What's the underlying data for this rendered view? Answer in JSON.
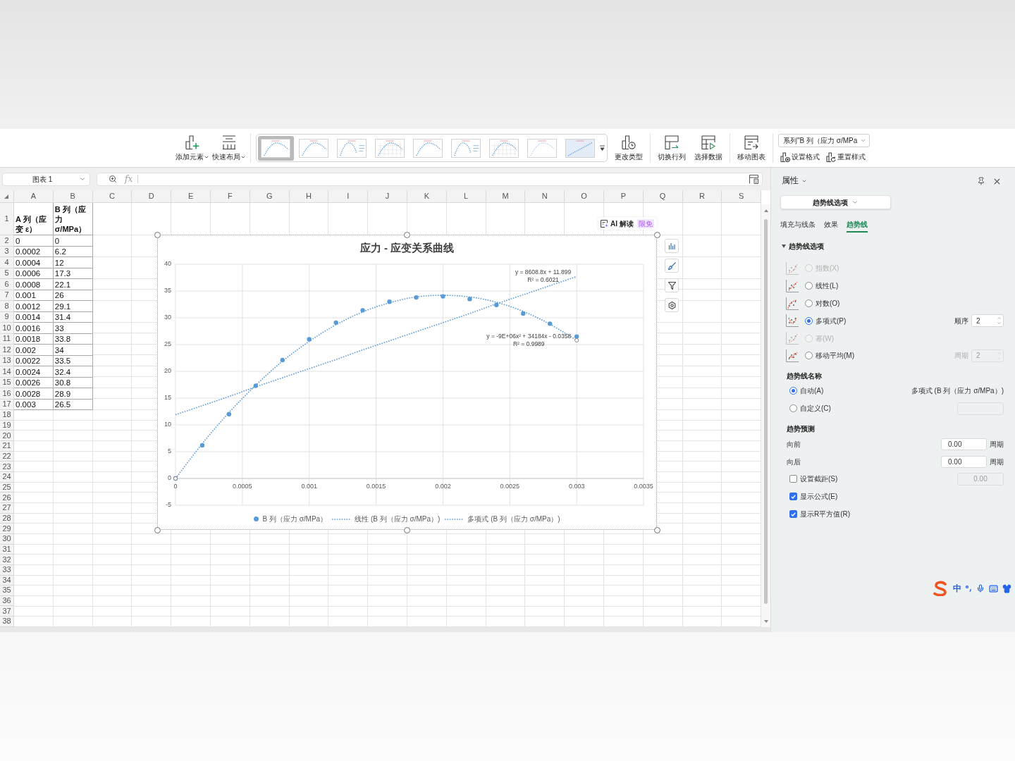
{
  "ribbon": {
    "groups": [
      {
        "kind": "buttons",
        "buttons": [
          {
            "kind": "add_element",
            "label": "添加元素",
            "dropdown": true
          },
          {
            "kind": "quick_layout",
            "label": "快速布局",
            "dropdown": true
          }
        ]
      },
      {
        "kind": "styles",
        "styles": [
          {
            "kind": "curve",
            "selected": true
          },
          {
            "kind": "curve",
            "selected": false
          },
          {
            "kind": "legend",
            "selected": false
          },
          {
            "kind": "grid",
            "selected": false
          },
          {
            "kind": "curve",
            "selected": false
          },
          {
            "kind": "legend",
            "selected": false
          },
          {
            "kind": "grid",
            "selected": false
          },
          {
            "kind": "faint",
            "selected": false
          },
          {
            "kind": "filled",
            "selected": false
          }
        ]
      },
      {
        "kind": "buttons",
        "buttons": [
          {
            "kind": "change_type",
            "label": "更改类型",
            "dropdown": false
          }
        ]
      },
      {
        "kind": "buttons",
        "buttons": [
          {
            "kind": "switch_row_column",
            "label": "切换行列",
            "dropdown": false
          },
          {
            "kind": "select_data",
            "label": "选择数据",
            "dropdown": false
          }
        ]
      },
      {
        "kind": "buttons",
        "buttons": [
          {
            "kind": "move_chart",
            "label": "移动图表",
            "dropdown": false
          }
        ]
      },
      {
        "kind": "series",
        "select": {
          "value": "系列\"B 列（应力 σ/MPa"
        },
        "buttons": [
          {
            "kind": "format",
            "label": "设置格式"
          },
          {
            "kind": "reset",
            "label": "重置样式"
          }
        ]
      }
    ]
  },
  "name_box": {
    "value": "图表 1"
  },
  "formula_bar": {
    "fx": "fx"
  },
  "sheet": {
    "columns": [
      "A",
      "B",
      "C",
      "D",
      "E",
      "F",
      "G",
      "H",
      "I",
      "J",
      "K",
      "L",
      "M",
      "N",
      "O",
      "P",
      "Q",
      "R",
      "S"
    ],
    "rows": [
      {
        "number": "1",
        "kind": "header",
        "cells": [
          "A 列（应变 ε）",
          "B 列（应力 σ/MPa）"
        ]
      },
      {
        "number": "2",
        "kind": "data",
        "cells": [
          "0",
          "0"
        ]
      },
      {
        "number": "3",
        "kind": "data",
        "cells": [
          "0.0002",
          "6.2"
        ]
      },
      {
        "number": "4",
        "kind": "data",
        "cells": [
          "0.0004",
          "12"
        ]
      },
      {
        "number": "5",
        "kind": "data",
        "cells": [
          "0.0006",
          "17.3"
        ]
      },
      {
        "number": "6",
        "kind": "data",
        "cells": [
          "0.0008",
          "22.1"
        ]
      },
      {
        "number": "7",
        "kind": "data",
        "cells": [
          "0.001",
          "26"
        ]
      },
      {
        "number": "8",
        "kind": "data",
        "cells": [
          "0.0012",
          "29.1"
        ]
      },
      {
        "number": "9",
        "kind": "data",
        "cells": [
          "0.0014",
          "31.4"
        ]
      },
      {
        "number": "10",
        "kind": "data",
        "cells": [
          "0.0016",
          "33"
        ]
      },
      {
        "number": "11",
        "kind": "data",
        "cells": [
          "0.0018",
          "33.8"
        ]
      },
      {
        "number": "12",
        "kind": "data",
        "cells": [
          "0.002",
          "34"
        ]
      },
      {
        "number": "13",
        "kind": "data",
        "cells": [
          "0.0022",
          "33.5"
        ]
      },
      {
        "number": "14",
        "kind": "data",
        "cells": [
          "0.0024",
          "32.4"
        ]
      },
      {
        "number": "15",
        "kind": "data",
        "cells": [
          "0.0026",
          "30.8"
        ]
      },
      {
        "number": "16",
        "kind": "data",
        "cells": [
          "0.0028",
          "28.9"
        ]
      },
      {
        "number": "17",
        "kind": "data",
        "cells": [
          "0.003",
          "26.5"
        ]
      },
      {
        "number": "18",
        "kind": "empty"
      },
      {
        "number": "19",
        "kind": "empty"
      },
      {
        "number": "20",
        "kind": "empty"
      },
      {
        "number": "21",
        "kind": "empty"
      },
      {
        "number": "22",
        "kind": "empty"
      },
      {
        "number": "23",
        "kind": "empty"
      },
      {
        "number": "24",
        "kind": "empty"
      },
      {
        "number": "25",
        "kind": "empty"
      },
      {
        "number": "26",
        "kind": "empty"
      },
      {
        "number": "27",
        "kind": "empty"
      },
      {
        "number": "28",
        "kind": "empty"
      },
      {
        "number": "29",
        "kind": "empty"
      },
      {
        "number": "30",
        "kind": "empty"
      },
      {
        "number": "31",
        "kind": "empty"
      },
      {
        "number": "32",
        "kind": "empty"
      },
      {
        "number": "33",
        "kind": "empty"
      },
      {
        "number": "34",
        "kind": "empty"
      },
      {
        "number": "35",
        "kind": "empty"
      },
      {
        "number": "36",
        "kind": "empty"
      },
      {
        "number": "37",
        "kind": "empty"
      },
      {
        "number": "38",
        "kind": "empty"
      }
    ]
  },
  "chart": {
    "ai_button": {
      "label": "AI 解读",
      "badge": "限免"
    },
    "series_selection": [
      {
        "selected": false
      },
      {
        "selected": false
      },
      {
        "selected": true
      }
    ],
    "chart_data": {
      "type": "scatter",
      "title": "应力 - 应变关系曲线",
      "x": [
        0,
        0.0002,
        0.0004,
        0.0006,
        0.0008,
        0.001,
        0.0012,
        0.0014,
        0.0016,
        0.0018,
        0.002,
        0.0022,
        0.0024,
        0.0026,
        0.0028,
        0.003
      ],
      "series": [
        {
          "name": "B 列（应力 σ/MPa）",
          "type": "scatter",
          "color": "#5b9bd5",
          "values": [
            0,
            6.2,
            12,
            17.3,
            22.1,
            26,
            29.1,
            31.4,
            33,
            33.8,
            34,
            33.5,
            32.4,
            30.8,
            28.9,
            26.5
          ]
        },
        {
          "name": "线性 (B 列（应力 σ/MPa）)",
          "type": "line",
          "line_style": "dotted",
          "color": "#5b9bd5",
          "values": [
            11.9,
            13.6,
            15.3,
            17.1,
            18.8,
            20.5,
            22.2,
            24,
            25.7,
            27.4,
            29.1,
            30.8,
            32.6,
            34.3,
            36,
            37.7
          ]
        },
        {
          "name": "多项式 (B 列（应力 σ/MPa）)",
          "type": "line",
          "line_style": "dotted",
          "color": "#5b9bd5",
          "values": [
            0,
            6.5,
            12.3,
            17.4,
            21.9,
            25.6,
            28.7,
            31.1,
            32.8,
            33.9,
            34.2,
            33.9,
            32.9,
            31.2,
            28.8,
            25.8
          ]
        }
      ],
      "xlim": [
        0,
        0.0035
      ],
      "ylim": [
        -5,
        40
      ],
      "xticks": [
        {
          "value": 0,
          "label": "0"
        },
        {
          "value": 0.0005,
          "label": "0.0005"
        },
        {
          "value": 0.001,
          "label": "0.001"
        },
        {
          "value": 0.0015,
          "label": "0.0015"
        },
        {
          "value": 0.002,
          "label": "0.002"
        },
        {
          "value": 0.0025,
          "label": "0.0025"
        },
        {
          "value": 0.003,
          "label": "0.003"
        },
        {
          "value": 0.0035,
          "label": "0.0035"
        }
      ],
      "yticks": [
        {
          "value": -5,
          "label": "-5"
        },
        {
          "value": 0,
          "label": "0"
        },
        {
          "value": 5,
          "label": "5"
        },
        {
          "value": 10,
          "label": "10"
        },
        {
          "value": 15,
          "label": "15"
        },
        {
          "value": 20,
          "label": "20"
        },
        {
          "value": 25,
          "label": "25"
        },
        {
          "value": 30,
          "label": "30"
        },
        {
          "value": 35,
          "label": "35"
        },
        {
          "value": 40,
          "label": "40"
        }
      ],
      "grid": true,
      "legend": "bottom",
      "annotations": [
        "y = 8608.8x + 11.899",
        "R² = 0.6021",
        "y = -9E+06x² + 34184x - 0.0358",
        "R² = 0.9989"
      ]
    }
  },
  "panel": {
    "title": "属性",
    "format_select": {
      "value": "趋势线选项"
    },
    "tabs": [
      {
        "label": "填充与线条",
        "selected": false
      },
      {
        "label": "效果",
        "selected": false
      },
      {
        "label": "趋势线",
        "selected": true
      }
    ],
    "trend_options": {
      "title": "趋势线选项",
      "expanded": true,
      "types": [
        {
          "kind": "exponential",
          "label": "指数(X)",
          "selected": false,
          "disabled": true
        },
        {
          "kind": "linear",
          "label": "线性(L)",
          "selected": false,
          "disabled": false
        },
        {
          "kind": "logarithmic",
          "label": "对数(O)",
          "selected": false,
          "disabled": false
        },
        {
          "kind": "polynomial",
          "label": "多项式(P)",
          "selected": true,
          "disabled": false,
          "setting": {
            "label": "顺序",
            "value": "2",
            "disabled": false
          }
        },
        {
          "kind": "power",
          "label": "幂(W)",
          "selected": false,
          "disabled": true
        },
        {
          "kind": "moving_average",
          "label": "移动平均(M)",
          "selected": false,
          "disabled": false,
          "setting": {
            "label": "周期",
            "value": "2",
            "disabled": true
          }
        }
      ]
    },
    "trend_name": {
      "title": "趋势线名称",
      "options": [
        {
          "kind": "auto",
          "label": "自动(A)",
          "selected": true,
          "value": "多项式 (B 列（应力 σ/MPa）)"
        },
        {
          "kind": "custom",
          "label": "自定义(C)",
          "selected": false,
          "field_disabled": true
        }
      ]
    },
    "forecast": {
      "title": "趋势预测",
      "rows": [
        {
          "label": "向前",
          "value": "0.00",
          "unit": "周期"
        },
        {
          "label": "向后",
          "value": "0.00",
          "unit": "周期"
        }
      ]
    },
    "checks": [
      {
        "label": "设置截距(S)",
        "checked": false,
        "field": {
          "value": "0.00",
          "disabled": true
        }
      },
      {
        "label": "显示公式(E)",
        "checked": true
      },
      {
        "label": "显示R平方值(R)",
        "checked": true
      }
    ]
  },
  "ime_toolbar": {
    "mode": "中"
  }
}
